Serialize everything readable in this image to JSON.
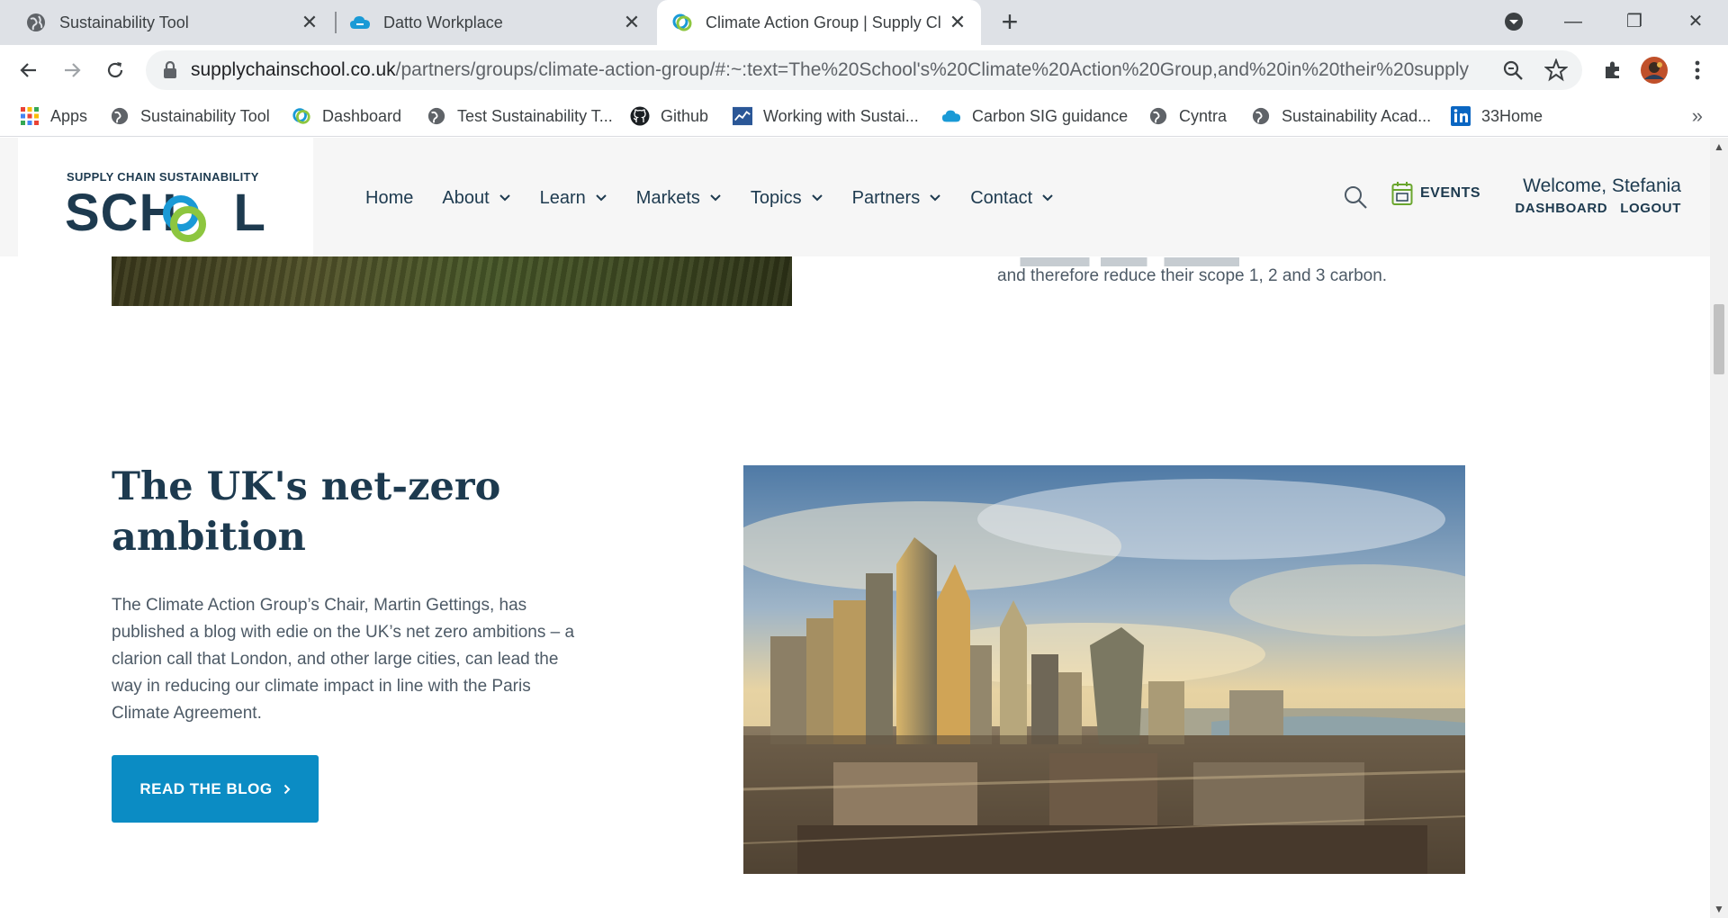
{
  "browser": {
    "tabs": [
      {
        "title": "Sustainability Tool",
        "icon": "globe-icon",
        "active": false
      },
      {
        "title": "Datto Workplace",
        "icon": "cloud-icon",
        "active": false
      },
      {
        "title": "Climate Action Group | Supply Cl",
        "icon": "school-icon",
        "active": true
      }
    ],
    "url_host": "supplychainschool.co.uk",
    "url_path": "/partners/groups/climate-action-group/#:~:text=The%20School's%20Climate%20Action%20Group,and%20in%20their%20supply...",
    "bookmarks": [
      {
        "label": "Apps",
        "icon": "apps-grid-icon"
      },
      {
        "label": "Sustainability Tool",
        "icon": "globe-icon"
      },
      {
        "label": "Dashboard",
        "icon": "school-icon"
      },
      {
        "label": "Test Sustainability T...",
        "icon": "globe-icon"
      },
      {
        "label": "Github",
        "icon": "github-icon"
      },
      {
        "label": "Working with Sustai...",
        "icon": "chart-icon"
      },
      {
        "label": "Carbon SIG guidance",
        "icon": "cloud-icon"
      },
      {
        "label": "Cyntra",
        "icon": "globe-icon"
      },
      {
        "label": "Sustainability Acad...",
        "icon": "globe-icon"
      },
      {
        "label": "33Home",
        "icon": "linkedin-icon"
      }
    ],
    "bookmarks_overflow": "»"
  },
  "site": {
    "logo_top": "SUPPLY CHAIN SUSTAINABILITY",
    "logo_main_left": "SCH",
    "logo_main_right": "L",
    "nav": [
      {
        "label": "Home",
        "has_dropdown": false
      },
      {
        "label": "About",
        "has_dropdown": true
      },
      {
        "label": "Learn",
        "has_dropdown": true
      },
      {
        "label": "Markets",
        "has_dropdown": true
      },
      {
        "label": "Topics",
        "has_dropdown": true
      },
      {
        "label": "Partners",
        "has_dropdown": true
      },
      {
        "label": "Contact",
        "has_dropdown": true
      }
    ],
    "events_label": "EVENTS",
    "welcome": "Welcome, Stefania",
    "dashboard_link": "DASHBOARD",
    "logout_link": "LOGOUT"
  },
  "content": {
    "prev_paragraph_end": "and therefore reduce their scope 1, 2 and 3 carbon.",
    "section_title": "The UK's net-zero ambition",
    "section_body": "The Climate Action Group’s Chair, Martin Gettings, has published a blog with edie on the UK’s net zero ambitions – a clarion call that London, and other large cities, can lead the way in reducing our climate impact in line with the Paris Climate Agreement.",
    "cta_label": "READ THE BLOG"
  },
  "colors": {
    "brand_navy": "#1d3a4f",
    "brand_blue": "#0b8cc4",
    "brand_green": "#8dc63f",
    "body_text": "#4d5a66"
  }
}
